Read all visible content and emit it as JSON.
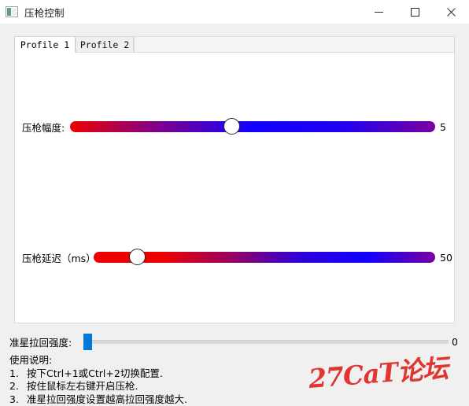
{
  "window": {
    "title": "压枪控制",
    "icon": "picture-icon",
    "controls": {
      "minimize": "—",
      "maximize": "□",
      "close": "✕"
    }
  },
  "tabs": [
    {
      "label": "Profile 1",
      "active": true
    },
    {
      "label": "Profile 2",
      "active": false
    }
  ],
  "sliders": [
    {
      "label": "压枪幅度:",
      "value": "5",
      "handle_percent": 44,
      "gradient": [
        "#ee0000",
        "#7a0090",
        "#1000ff",
        "#2000f0",
        "#7b00a0"
      ]
    },
    {
      "label": "压枪延迟（ms）:",
      "value": "50",
      "handle_percent": 11,
      "gradient": [
        "#ee0000",
        "#ee0000",
        "#9a0060",
        "#3000d8",
        "#1000ff",
        "#7b00a0"
      ]
    }
  ],
  "strength": {
    "label": "准星拉回强度:",
    "value": "0",
    "handle_percent": 0,
    "accent": "#0078d7"
  },
  "help": {
    "title": "使用说明:",
    "items": [
      {
        "num": "1.",
        "text": "按下Ctrl+1或Ctrl+2切换配置."
      },
      {
        "num": "2.",
        "text": "按住鼠标左右键开启压枪."
      },
      {
        "num": "3.",
        "text": "准星拉回强度设置越高拉回强度越大."
      }
    ]
  },
  "watermark": {
    "text": "27CaT论坛",
    "color": "#e0362f"
  }
}
